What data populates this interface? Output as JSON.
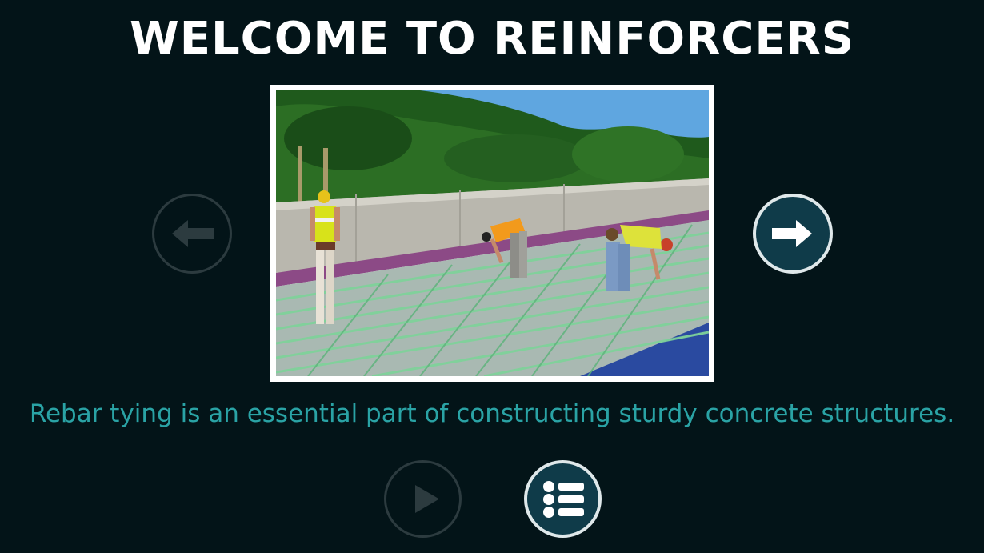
{
  "header": {
    "title": "WELCOME TO REINFORCERS"
  },
  "slide": {
    "caption": "Rebar tying is an essential part of constructing sturdy concrete structures.",
    "image_subject": "construction workers tying green epoxy-coated rebar on a bridge deck"
  },
  "controls": {
    "prev_icon": "arrow-left-icon",
    "next_icon": "arrow-right-icon",
    "play_icon": "play-icon",
    "menu_icon": "list-menu-icon",
    "prev_enabled": false,
    "play_enabled": false
  },
  "colors": {
    "background": "#031418",
    "title": "#ffffff",
    "caption": "#2aa3a5",
    "active_button_fill": "#0f3b49",
    "active_button_border": "#dfe8ea",
    "inactive_button_border": "#2c3b3f"
  }
}
